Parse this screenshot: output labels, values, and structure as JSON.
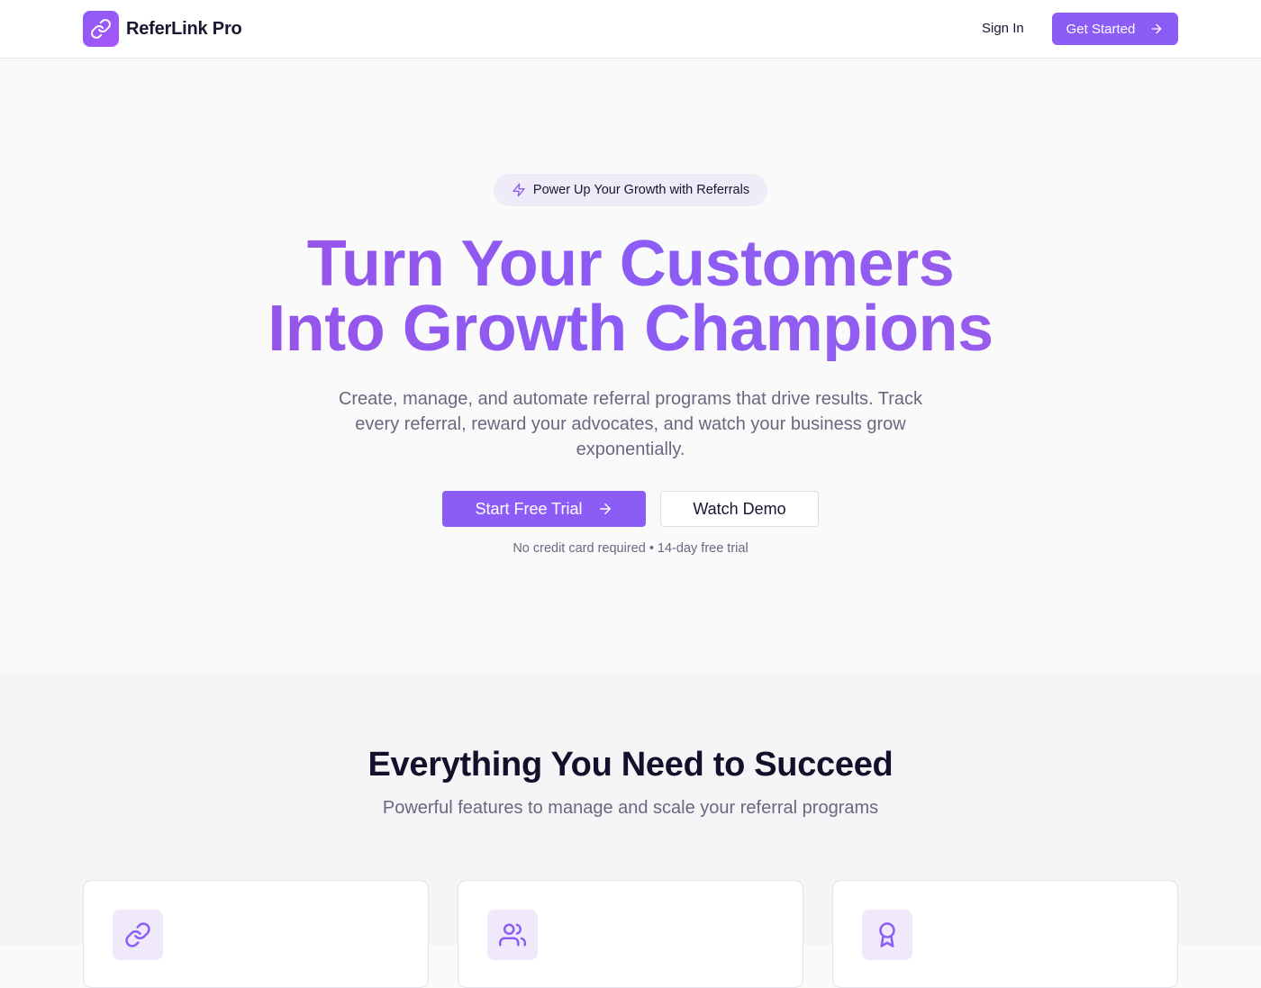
{
  "header": {
    "brand_name": "ReferLink Pro",
    "logo_icon": "link-icon",
    "signin_label": "Sign In",
    "get_started_label": "Get Started"
  },
  "hero": {
    "badge_icon": "lightning-icon",
    "badge_text": "Power Up Your Growth with Referrals",
    "title_line1": "Turn Your Customers",
    "title_line2": "Into Growth Champions",
    "subtitle": "Create, manage, and automate referral programs that drive results. Track every referral, reward your advocates, and watch your business grow exponentially.",
    "primary_cta": "Start Free Trial",
    "secondary_cta": "Watch Demo",
    "note": "No credit card required • 14-day free trial"
  },
  "features": {
    "title": "Everything You Need to Succeed",
    "subtitle": "Powerful features to manage and scale your referral programs",
    "cards": [
      {
        "icon": "link-icon"
      },
      {
        "icon": "users-icon"
      },
      {
        "icon": "award-icon"
      }
    ]
  },
  "colors": {
    "accent": "#8b5cf6",
    "accent_light": "#efe9fb",
    "text_dark": "#1a1530",
    "text_muted": "#6b6780"
  }
}
